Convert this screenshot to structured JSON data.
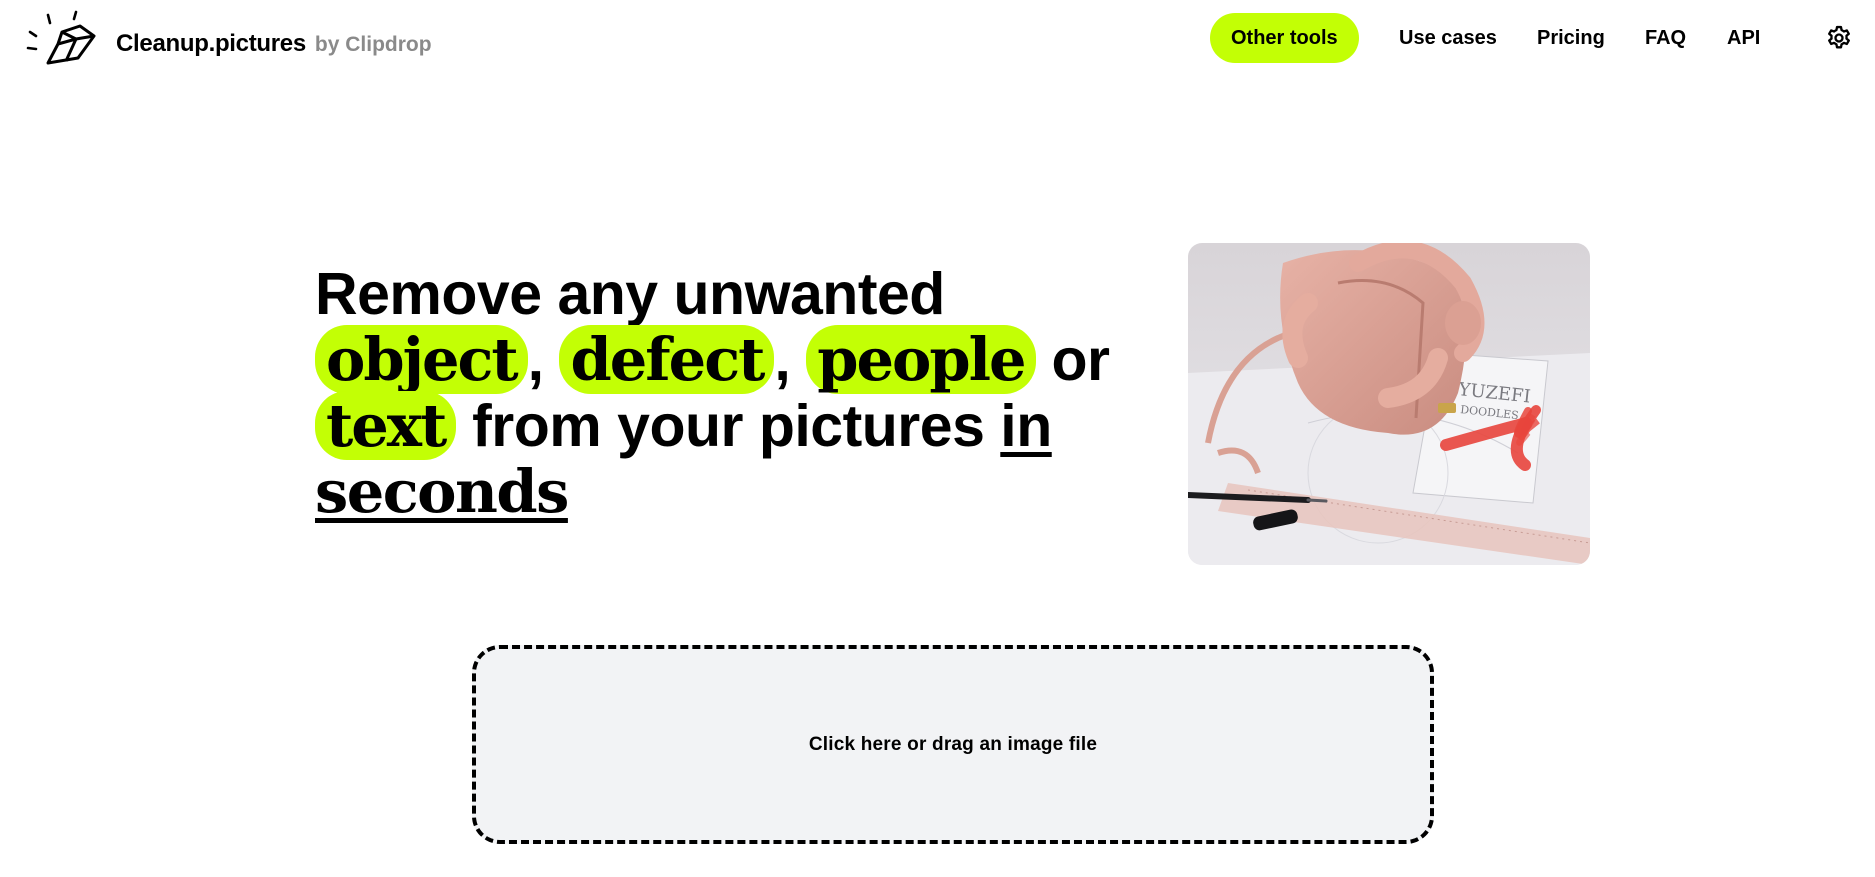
{
  "header": {
    "brand_name": "Cleanup.pictures",
    "brand_by": "by Clipdrop",
    "logo_icon": "eraser-icon",
    "settings_icon": "gear-icon"
  },
  "nav": {
    "items": [
      {
        "label": "Other tools",
        "highlighted": true
      },
      {
        "label": "Use cases"
      },
      {
        "label": "Pricing"
      },
      {
        "label": "FAQ"
      },
      {
        "label": "API"
      }
    ]
  },
  "hero": {
    "line1": "Remove any unwanted",
    "word_object": "object",
    "comma1": ",",
    "word_defect": "defect",
    "comma2": ",",
    "word_people": "people",
    "word_or": "or",
    "word_text": "text",
    "mid_text": "from your pictures",
    "word_in": "in",
    "word_seconds": "seconds",
    "image_icon": "sample-photo-pink-handbag"
  },
  "dropzone": {
    "label": "Click here or drag an image file"
  },
  "colors": {
    "accent": "#c3ff05",
    "dropzone_bg": "#f2f3f5",
    "text": "#000000",
    "muted": "#8a8a8a"
  }
}
